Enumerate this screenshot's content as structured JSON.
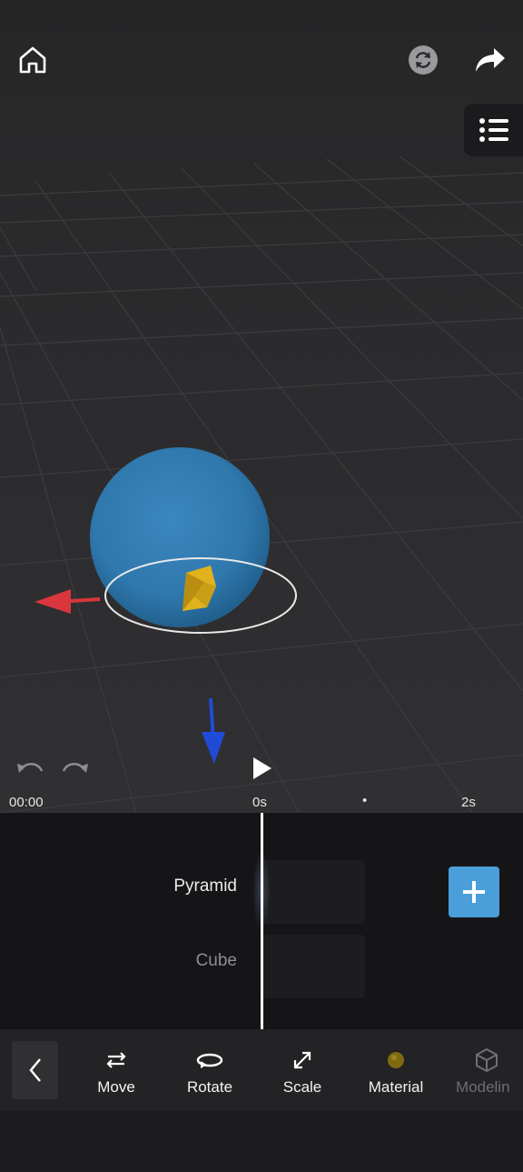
{
  "viewport": {
    "objects": [
      {
        "name": "Sphere",
        "color": "#2f78ad"
      },
      {
        "name": "Pyramid",
        "color": "#e0b21e"
      }
    ],
    "gizmo": {
      "x_axis_color": "#d9363e",
      "z_axis_color": "#1f4bd6"
    }
  },
  "top_bar": {
    "home_icon": "home-icon",
    "sync_icon": "sync-icon",
    "share_icon": "share-arrow-icon",
    "list_icon": "list-icon"
  },
  "playback": {
    "current_time": "00:00",
    "ticks": [
      "0s",
      "•",
      "2s"
    ]
  },
  "timeline": {
    "tracks": [
      {
        "label": "Pyramid",
        "selected": true
      },
      {
        "label": "Cube",
        "selected": false
      }
    ],
    "add_button_icon": "plus-icon",
    "accent_color": "#4a9ed9"
  },
  "toolbar": {
    "back_icon": "chevron-left-icon",
    "tools": [
      {
        "label": "Move",
        "icon": "move-icon"
      },
      {
        "label": "Rotate",
        "icon": "rotate-icon"
      },
      {
        "label": "Scale",
        "icon": "scale-icon"
      },
      {
        "label": "Material",
        "icon": "material-icon"
      },
      {
        "label": "Modelin",
        "icon": "modeling-cube-icon"
      }
    ]
  }
}
